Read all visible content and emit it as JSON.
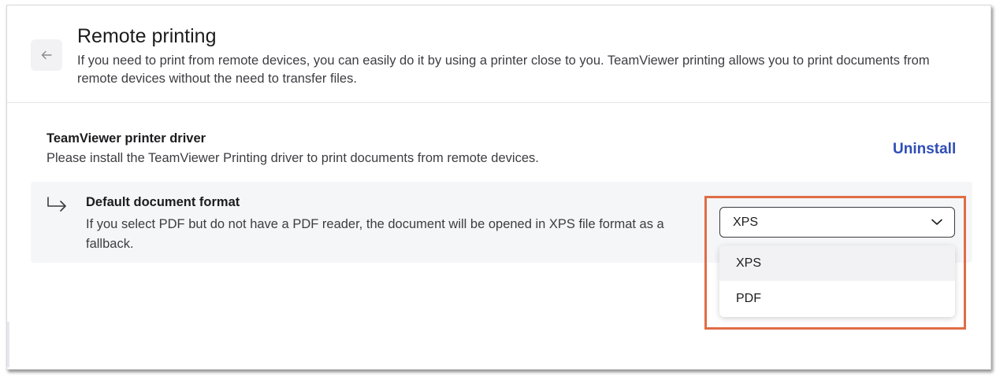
{
  "header": {
    "title": "Remote printing",
    "description": "If you need to print from remote devices, you can easily do it by using a printer close to you. TeamViewer printing allows you to print documents from remote devices without the need to transfer files.",
    "back_icon": "arrow-left-icon"
  },
  "driver": {
    "title": "TeamViewer printer driver",
    "description": "Please install the TeamViewer Printing driver to print documents from remote devices.",
    "action_label": "Uninstall"
  },
  "document_format": {
    "title": "Default document format",
    "description": "If you select PDF but do not have a PDF reader, the document will be opened in XPS file format as a fallback.",
    "selected_value": "XPS",
    "options": [
      "XPS",
      "PDF"
    ],
    "icon": "subdirectory-arrow-icon"
  },
  "colors": {
    "accent_link": "#2f4eb5",
    "highlight": "#e06d45",
    "row_background": "#f5f6f8"
  }
}
